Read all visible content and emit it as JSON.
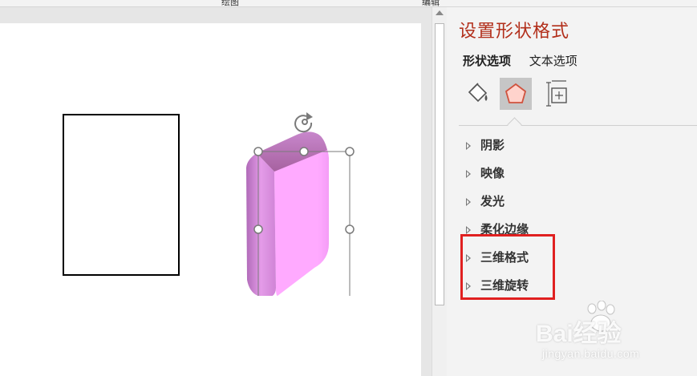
{
  "pane": {
    "title": "设置形状格式",
    "tabs": [
      {
        "label": "形状选项",
        "active": true
      },
      {
        "label": "文本选项",
        "active": false
      }
    ],
    "icons": [
      {
        "name": "fill-line-icon",
        "selected": false
      },
      {
        "name": "effects-pentagon-icon",
        "selected": true
      },
      {
        "name": "size-properties-icon",
        "selected": false
      }
    ],
    "sections": [
      {
        "label": "阴影"
      },
      {
        "label": "映像"
      },
      {
        "label": "发光"
      },
      {
        "label": "柔化边缘"
      },
      {
        "label": "三维格式"
      },
      {
        "label": "三维旋转"
      }
    ]
  },
  "top_strip": {
    "fragments": [
      "绘图",
      "编辑"
    ]
  },
  "colors": {
    "title": "#b22f1b",
    "highlight": "#e02020",
    "shape_fill": "#ffaaff",
    "selected_icon_bg": "#c6c6c6"
  },
  "watermark": {
    "main": "Bai经验",
    "sub": "jingyan.baidu.com"
  }
}
